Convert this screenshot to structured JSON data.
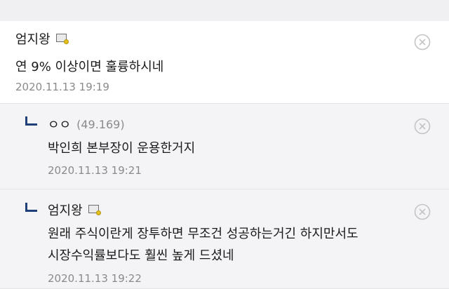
{
  "comments": [
    {
      "author": "엄지왕",
      "body_lines": [
        "연 9% 이상이면 훌륭하시네"
      ],
      "timestamp": "2020.11.13 19:19"
    }
  ],
  "replies": [
    {
      "author": "ㅇㅇ",
      "ip": "(49.169)",
      "body_lines": [
        "박인희 본부장이 운용한거지"
      ],
      "timestamp": "2020.11.13 19:21"
    },
    {
      "author": "엄지왕",
      "body_lines": [
        "원래 주식이란게 장투하면 무조건 성공하는거긴 하지만서도",
        "시장수익률보다도 훨씬 높게 드셨네"
      ],
      "timestamp": "2020.11.13 19:22"
    }
  ],
  "icons": {
    "delete": "close-circle-icon",
    "user_badge": "image-badge-icon",
    "reply": "reply-arrow-icon"
  },
  "colors": {
    "reply_background": "#f4f4f6",
    "reply_mark": "#1f3f78",
    "meta_text": "#8a8a8a"
  }
}
